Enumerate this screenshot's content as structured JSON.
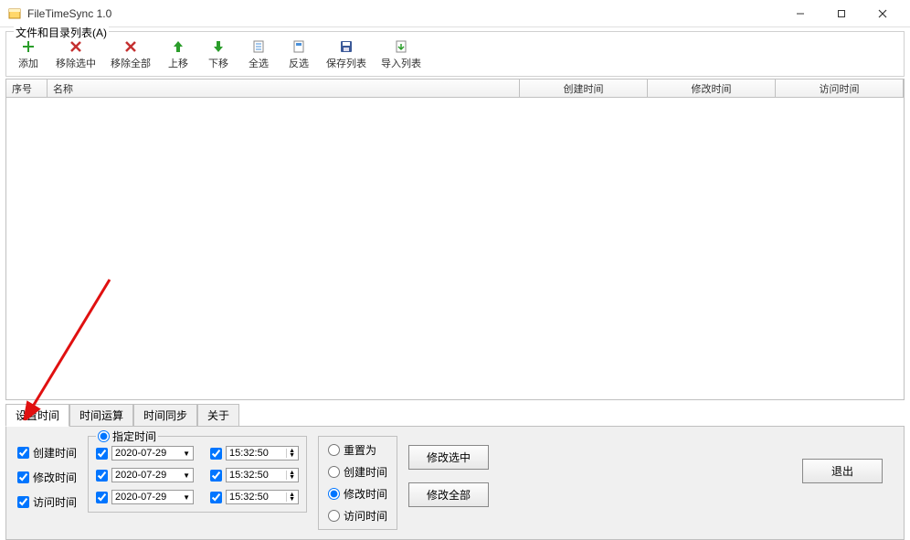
{
  "window": {
    "title": "FileTimeSync 1.0"
  },
  "groupbox": {
    "legend": "文件和目录列表(A)"
  },
  "toolbar": {
    "add": "添加",
    "remove_selected": "移除选中",
    "remove_all": "移除全部",
    "move_up": "上移",
    "move_down": "下移",
    "select_all": "全选",
    "invert_selection": "反选",
    "save_list": "保存列表",
    "import_list": "导入列表"
  },
  "table": {
    "col_index": "序号",
    "col_name": "名称",
    "col_created": "创建时间",
    "col_modified": "修改时间",
    "col_accessed": "访问时间"
  },
  "tabs": {
    "set_time": "设置时间",
    "time_calc": "时间运算",
    "time_sync": "时间同步",
    "about": "关于"
  },
  "set_time_panel": {
    "created_time": "创建时间",
    "modified_time": "修改时间",
    "accessed_time": "访问时间",
    "specify_time": "指定时间",
    "date1": "2020-07-29",
    "date2": "2020-07-29",
    "date3": "2020-07-29",
    "time1": "15:32:50",
    "time2": "15:32:50",
    "time3": "15:32:50",
    "reset_to": "重置为",
    "reset_created": "创建时间",
    "reset_modified": "修改时间",
    "reset_accessed": "访问时间",
    "modify_selected": "修改选中",
    "modify_all": "修改全部",
    "exit": "退出"
  }
}
